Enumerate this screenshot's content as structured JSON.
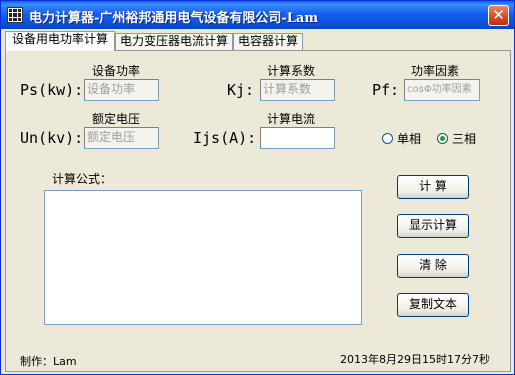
{
  "window": {
    "title": "电力计算器-广州裕邦通用电气设备有限公司-Lam",
    "close_glyph": "✕"
  },
  "tabs": [
    {
      "label": "设备用电功率计算"
    },
    {
      "label": "电力变压器电流计算"
    },
    {
      "label": "电容器计算"
    }
  ],
  "form": {
    "ps": {
      "symbol": "Ps(kw):",
      "caption": "设备功率",
      "placeholder": "设备功率"
    },
    "kj": {
      "symbol": "Kj:",
      "caption": "计算系数",
      "placeholder": "计算系数"
    },
    "pf": {
      "symbol": "Pf:",
      "caption": "功率因素",
      "placeholder": "cosΦ功率因素"
    },
    "un": {
      "symbol": "Un(kv):",
      "caption": "额定电压",
      "placeholder": "额定电压"
    },
    "ijs": {
      "symbol": "Ijs(A):",
      "caption": "计算电流",
      "value": ""
    },
    "phase": {
      "single": "单相",
      "three": "三相",
      "selected": "three"
    }
  },
  "formula": {
    "label": "计算公式：",
    "content": ""
  },
  "buttons": {
    "calc": "计  算",
    "show_calc": "显示计算",
    "clear": "清  除",
    "copy_text": "复制文本"
  },
  "footer": {
    "author": "制作：Lam",
    "datetime": "2013年8月29日15时17分7秒"
  }
}
